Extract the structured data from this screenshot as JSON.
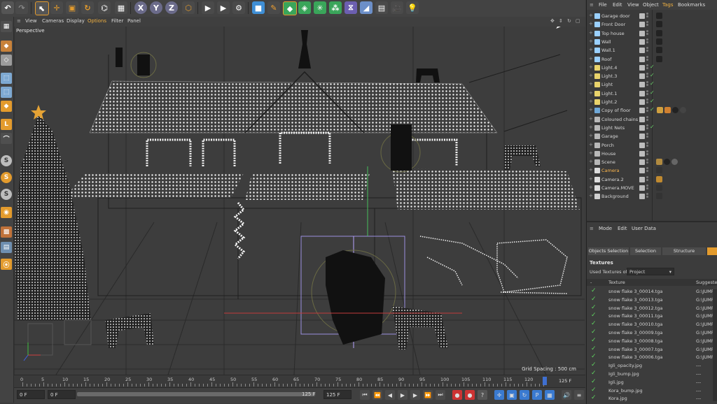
{
  "toolbar": {
    "axis_x": "X",
    "axis_y": "Y",
    "axis_z": "Z"
  },
  "viewport": {
    "menu": [
      "View",
      "Cameras",
      "Display",
      "Options",
      "Filter",
      "Panel"
    ],
    "label": "Perspective",
    "grid_spacing": "Grid Spacing : 500 cm"
  },
  "timeline": {
    "ticks": [
      "0",
      "5",
      "10",
      "15",
      "20",
      "25",
      "30",
      "35",
      "40",
      "45",
      "50",
      "55",
      "60",
      "65",
      "70",
      "75",
      "80",
      "85",
      "90",
      "95",
      "100",
      "105",
      "110",
      "115",
      "120"
    ],
    "end_label": "125 F"
  },
  "transport": {
    "current_frame": "0 F",
    "start_frame": "0 F",
    "range_end": "125 F",
    "max_frame": "125 F"
  },
  "object_manager": {
    "menu": [
      "File",
      "Edit",
      "View",
      "Object",
      "Tags",
      "Bookmarks"
    ],
    "objects": [
      {
        "name": "Garage door",
        "icon": "spline-icon",
        "color": "#9ad0ff"
      },
      {
        "name": "Front Door",
        "icon": "spline-icon",
        "color": "#9ad0ff"
      },
      {
        "name": "Top house",
        "icon": "spline-icon",
        "color": "#9ad0ff"
      },
      {
        "name": "Wall",
        "icon": "spline-icon",
        "color": "#9ad0ff"
      },
      {
        "name": "Wall.1",
        "icon": "spline-icon",
        "color": "#9ad0ff"
      },
      {
        "name": "Roof",
        "icon": "spline-icon",
        "color": "#9ad0ff"
      },
      {
        "name": "Light.4",
        "icon": "light-icon",
        "color": "#e9d36b"
      },
      {
        "name": "Light.3",
        "icon": "light-icon",
        "color": "#e9d36b"
      },
      {
        "name": "Light",
        "icon": "light-icon",
        "color": "#e9d36b"
      },
      {
        "name": "Light.1",
        "icon": "light-icon",
        "color": "#e9d36b"
      },
      {
        "name": "Light.2",
        "icon": "light-icon",
        "color": "#e9d36b"
      },
      {
        "name": "Copy of floor",
        "icon": "floor-icon",
        "color": "#6fa8d8"
      },
      {
        "name": "Coloured chains",
        "icon": "null-icon",
        "color": "#b8b8b8"
      },
      {
        "name": "Light Nets",
        "icon": "null-icon",
        "color": "#b8b8b8"
      },
      {
        "name": "Garage",
        "icon": "null-icon",
        "color": "#b8b8b8"
      },
      {
        "name": "Porch",
        "icon": "null-icon",
        "color": "#b8b8b8"
      },
      {
        "name": "House",
        "icon": "null-icon",
        "color": "#b8b8b8"
      },
      {
        "name": "Scene",
        "icon": "null-icon",
        "color": "#b8b8b8"
      },
      {
        "name": "Camera",
        "icon": "camera-icon",
        "color": "#dddddd",
        "highlight": true
      },
      {
        "name": "Camera.2",
        "icon": "camera-icon",
        "color": "#dddddd"
      },
      {
        "name": "Camera.MOVE",
        "icon": "camera-icon",
        "color": "#dddddd"
      },
      {
        "name": "Background",
        "icon": "background-icon",
        "color": "#cfcfcf"
      }
    ]
  },
  "attribute_manager": {
    "menu": [
      "Mode",
      "Edit",
      "User Data"
    ],
    "tabs": [
      "Objects Selection",
      "Selection",
      "Structure"
    ],
    "section_title": "Textures",
    "used_textures_label": "Used Textures of",
    "used_textures_value": "Project",
    "col_texture": "Texture",
    "col_suggested": "Suggested",
    "rows": [
      {
        "name": "snow flake 3_00014.tga",
        "path": "G:\\JUMP\\"
      },
      {
        "name": "snow flake 3_00013.tga",
        "path": "G:\\JUMP\\"
      },
      {
        "name": "snow flake 3_00012.tga",
        "path": "G:\\JUMP\\"
      },
      {
        "name": "snow flake 3_00011.tga",
        "path": "G:\\JUMP\\"
      },
      {
        "name": "snow flake 3_00010.tga",
        "path": "G:\\JUMP\\"
      },
      {
        "name": "snow flake 3_00009.tga",
        "path": "G:\\JUMP\\"
      },
      {
        "name": "snow flake 3_00008.tga",
        "path": "G:\\JUMP\\"
      },
      {
        "name": "snow flake 3_00007.tga",
        "path": "G:\\JUMP\\"
      },
      {
        "name": "snow flake 3_00006.tga",
        "path": "G:\\JUMP\\"
      },
      {
        "name": "Igli_opacity.jpg",
        "path": "---"
      },
      {
        "name": "Igli_bump.jpg",
        "path": "---"
      },
      {
        "name": "Igli.jpg",
        "path": "---"
      },
      {
        "name": "Kora_bump.jpg",
        "path": "---"
      },
      {
        "name": "Kora.jpg",
        "path": "---"
      }
    ]
  },
  "colors": {
    "accent_orange": "#e39b2d",
    "selected_camera": "#ffb84d",
    "check_green": "#5fd35f",
    "lights": "#ffffff"
  }
}
